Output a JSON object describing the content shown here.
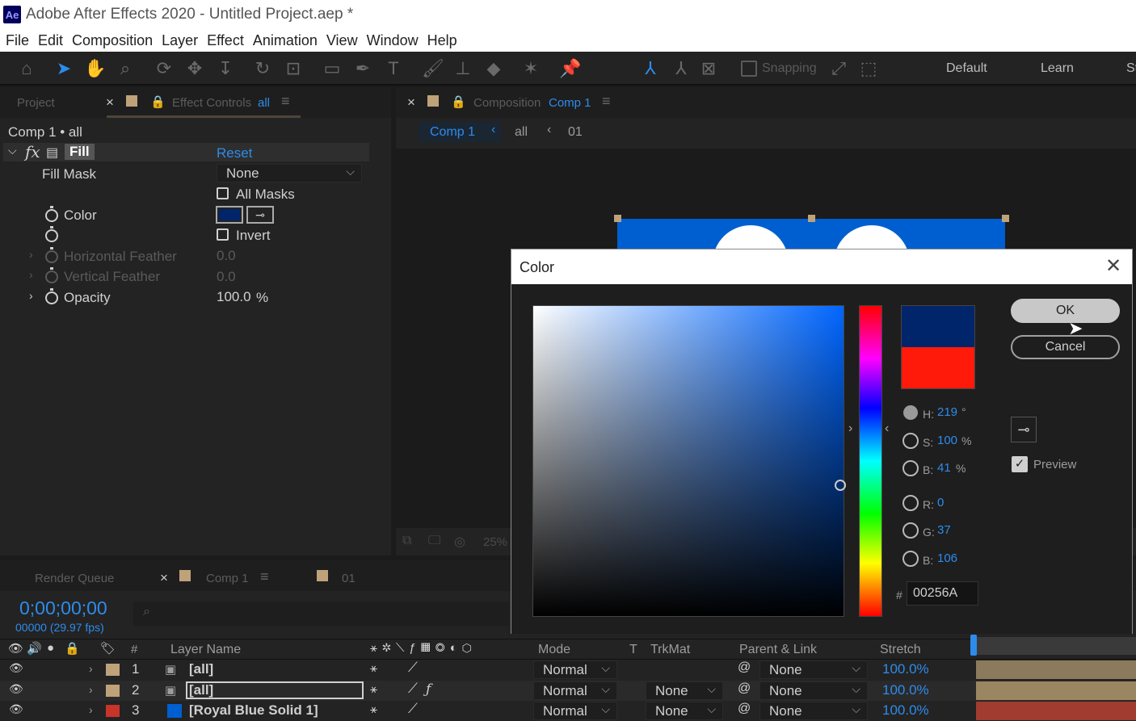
{
  "window": {
    "title": "Adobe After Effects 2020 - Untitled Project.aep *",
    "logo": "Ae"
  },
  "menu": [
    "File",
    "Edit",
    "Composition",
    "Layer",
    "Effect",
    "Animation",
    "View",
    "Window",
    "Help"
  ],
  "toolbar": {
    "snapping_label": "Snapping",
    "workspaces": [
      "Default",
      "Learn",
      "St"
    ]
  },
  "left_panel": {
    "tab_project": "Project",
    "tab_effect_controls": "Effect Controls",
    "tab_effect_controls_target": "all",
    "comp_path": "Comp 1 • all",
    "effect_name": "Fill",
    "fx_glyph": "fx",
    "reset_label": "Reset",
    "fill_mask_label": "Fill Mask",
    "fill_mask_value": "None",
    "all_masks_label": "All Masks",
    "color_label": "Color",
    "invert_label": "Invert",
    "h_feather_label": "Horizontal Feather",
    "h_feather_value": "0.0",
    "v_feather_label": "Vertical Feather",
    "v_feather_value": "0.0",
    "opacity_label": "Opacity",
    "opacity_value": "100.0",
    "opacity_unit": "%",
    "color_value": "#00256A"
  },
  "composition_panel": {
    "tab_label": "Composition",
    "tab_target": "Comp 1",
    "breadcrumbs": [
      "Comp 1",
      "all",
      "01"
    ],
    "zoom": "25%"
  },
  "color_dialog": {
    "title": "Color",
    "ok_label": "OK",
    "cancel_label": "Cancel",
    "h_label": "H:",
    "h_value": "219",
    "h_unit": "°",
    "s_label": "S:",
    "s_value": "100",
    "s_unit": "%",
    "b_label": "B:",
    "b_value": "41",
    "b_unit": "%",
    "r_label": "R:",
    "r_value": "0",
    "g_label": "G:",
    "g_value": "37",
    "b2_label": "B:",
    "b2_value": "106",
    "hex_prefix": "#",
    "hex_value": "00256A",
    "preview_label": "Preview",
    "new_color": "#00256A",
    "original_color": "#ff1a0a",
    "hue_base": "#0066ff"
  },
  "timeline": {
    "tab_render_queue": "Render Queue",
    "tab_comp": "Comp 1",
    "tab_01": "01",
    "timecode": "0;00;00;00",
    "frame_info": "00000 (29.97 fps)",
    "columns": {
      "hash": "#",
      "layer_name": "Layer Name",
      "mode": "Mode",
      "t": "T",
      "trkmat": "TrkMat",
      "parent": "Parent & Link",
      "stretch": "Stretch"
    },
    "layers": [
      {
        "num": "1",
        "name": "[all]",
        "mode": "Normal",
        "trkmat": "",
        "parent": "None",
        "stretch": "100.0%",
        "label_color": "#bfa27a"
      },
      {
        "num": "2",
        "name": "[all]",
        "mode": "Normal",
        "trkmat": "None",
        "parent": "None",
        "stretch": "100.0%",
        "label_color": "#bfa27a"
      },
      {
        "num": "3",
        "name": "[Royal Blue Solid 1]",
        "mode": "Normal",
        "trkmat": "None",
        "parent": "None",
        "stretch": "100.0%",
        "label_color": "#c8342a"
      }
    ]
  }
}
